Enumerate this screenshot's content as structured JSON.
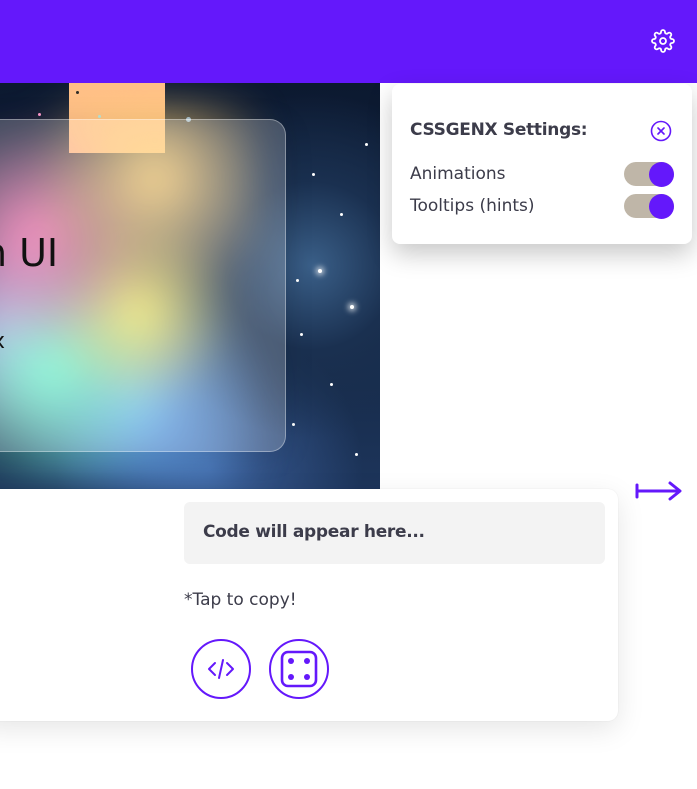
{
  "colors": {
    "accent": "#6418fb",
    "toggle_track": "#bfb6a8",
    "code_bg": "#f3f3f3"
  },
  "header": {
    "settings_icon": "gear-icon"
  },
  "preview": {
    "title": "m UI",
    "subtitle": "x"
  },
  "settings_panel": {
    "title": "CSSGENX Settings:",
    "close_icon": "close-circle-icon",
    "options": [
      {
        "label": "Animations",
        "enabled": true
      },
      {
        "label": "Tooltips (hints)",
        "enabled": true
      }
    ]
  },
  "navigation": {
    "next_icon": "arrow-right-icon"
  },
  "output": {
    "code_placeholder": "Code will appear here...",
    "copy_hint": "*Tap to copy!",
    "buttons": [
      {
        "icon": "code-icon"
      },
      {
        "icon": "dice-icon"
      }
    ]
  }
}
